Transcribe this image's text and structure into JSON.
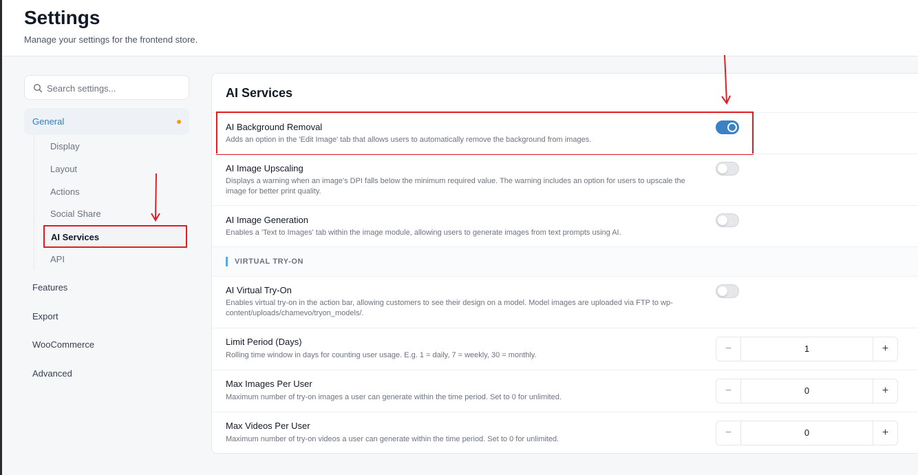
{
  "header": {
    "title": "Settings",
    "subtitle": "Manage your settings for the frontend store."
  },
  "sidebar": {
    "search_placeholder": "Search settings...",
    "general_label": "General",
    "sub_items": [
      "Display",
      "Layout",
      "Actions",
      "Social Share",
      "AI Services",
      "API"
    ],
    "items": [
      "Features",
      "Export",
      "WooCommerce",
      "Advanced"
    ]
  },
  "card": {
    "title": "AI Services",
    "rows": [
      {
        "title": "AI Background Removal",
        "desc": "Adds an option in the 'Edit Image' tab that allows users to automatically remove the background from images.",
        "enabled": true
      },
      {
        "title": "AI Image Upscaling",
        "desc": "Displays a warning when an image's DPI falls below the minimum required value. The warning includes an option for users to upscale the image for better print quality.",
        "enabled": false
      },
      {
        "title": "AI Image Generation",
        "desc": "Enables a 'Text to Images' tab within the image module, allowing users to generate images from text prompts using AI.",
        "enabled": false
      }
    ],
    "section_label": "VIRTUAL TRY-ON",
    "tryon": {
      "title": "AI Virtual Try-On",
      "desc": "Enables virtual try-on in the action bar, allowing customers to see their design on a model. Model images are uploaded via FTP to wp-content/uploads/chamevo/tryon_models/.",
      "enabled": false
    },
    "steppers": [
      {
        "title": "Limit Period (Days)",
        "desc": "Rolling time window in days for counting user usage. E.g. 1 = daily, 7 = weekly, 30 = monthly.",
        "value": "1"
      },
      {
        "title": "Max Images Per User",
        "desc": "Maximum number of try-on images a user can generate within the time period. Set to 0 for unlimited.",
        "value": "0"
      },
      {
        "title": "Max Videos Per User",
        "desc": "Maximum number of try-on videos a user can generate within the time period. Set to 0 for unlimited.",
        "value": "0"
      }
    ],
    "stepper_minus": "−",
    "stepper_plus": "+"
  },
  "colors": {
    "accent": "#3b82c4",
    "annotation": "#e11d24",
    "status_dot": "#f59e0b"
  }
}
